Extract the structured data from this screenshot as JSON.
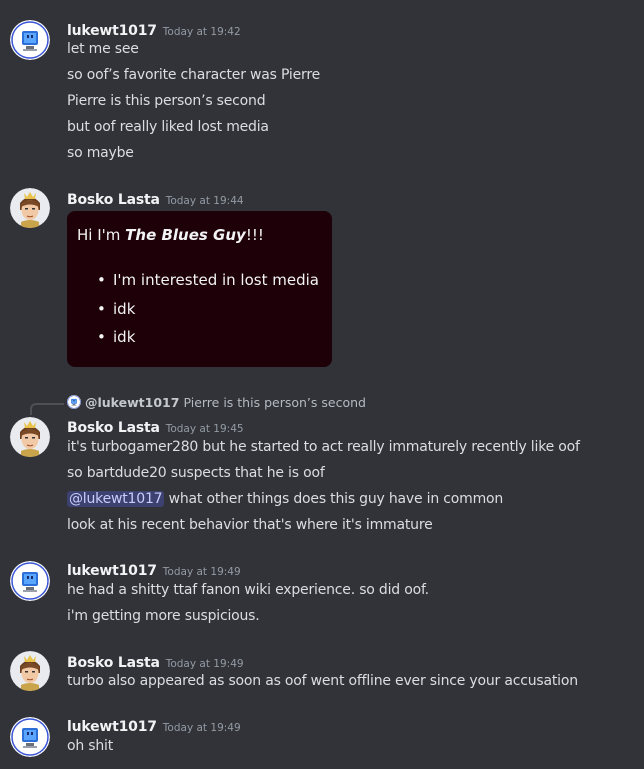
{
  "messages": [
    {
      "author": "lukewt1017",
      "timestamp": "Today at 19:42",
      "avatar_icon": "blue-monitor-avatar-icon",
      "lines": [
        "let me see",
        "so oof’s favorite character was Pierre",
        "Pierre is this person’s second",
        "but oof really liked lost media",
        "so maybe"
      ]
    },
    {
      "author": "Bosko Lasta",
      "timestamp": "Today at 19:44",
      "avatar_icon": "mii-character-avatar-icon",
      "embed": {
        "greeting_prefix": "Hi I'm ",
        "greeting_bold": "The Blues Guy",
        "greeting_suffix": "!!!",
        "items": [
          "I'm interested in lost media",
          "idk",
          "idk"
        ],
        "background": "#1e0008"
      }
    },
    {
      "author": "Bosko Lasta",
      "timestamp": "Today at 19:45",
      "avatar_icon": "mii-character-avatar-icon",
      "reply": {
        "mention": "@lukewt1017",
        "text": "Pierre is this person’s second"
      },
      "lines": [
        "it's turbogamer280 but he started to act really immaturely recently like oof",
        "so bartdude20 suspects that he is oof"
      ],
      "mention_line": {
        "mention": "@lukewt1017",
        "text": " what other things does this guy have in common"
      },
      "last_line": "look at his recent behavior that's where it's immature"
    },
    {
      "author": "lukewt1017",
      "timestamp": "Today at 19:49",
      "avatar_icon": "blue-monitor-avatar-icon",
      "lines": [
        "he had a shitty ttaf fanon wiki experience. so did oof.",
        "i'm getting more suspicious."
      ]
    },
    {
      "author": "Bosko Lasta",
      "timestamp": "Today at 19:49",
      "avatar_icon": "mii-character-avatar-icon",
      "lines": [
        "turbo also appeared as soon as oof went offline ever since your accusation"
      ]
    },
    {
      "author": "lukewt1017",
      "timestamp": "Today at 19:49",
      "avatar_icon": "blue-monitor-avatar-icon",
      "lines": [
        "oh shit"
      ]
    }
  ],
  "colors": {
    "background": "#313338",
    "text": "#dbdee1",
    "username": "#f2f3f5",
    "timestamp": "#949ba4",
    "mention_bg": "#5865f24d"
  }
}
